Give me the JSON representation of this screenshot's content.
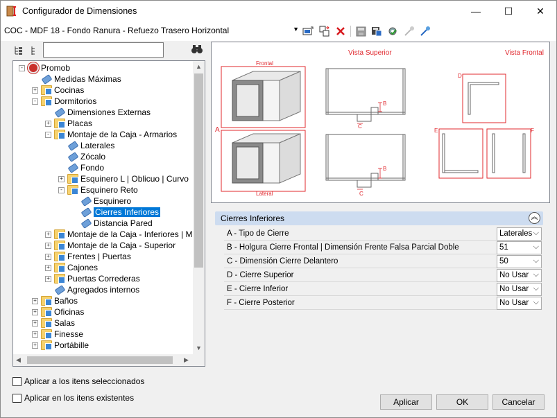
{
  "window": {
    "title": "Configurador de Dimensiones",
    "controls": {
      "minimize": "—",
      "maximize": "☐",
      "close": "✕"
    }
  },
  "toolbar": {
    "config_name": "COC - MDF 18 - Fondo Ranura - Refuezo Trasero Horizontal",
    "dropdown_arrow": "▼",
    "icons": [
      "new-config-icon",
      "copy-config-icon",
      "delete-config-icon",
      "save-icon",
      "save-as-icon",
      "settings-icon",
      "tool-disabled-icon",
      "tool-icon"
    ]
  },
  "tree_toolbar": {
    "search_value": "",
    "find_icon": "binoculars-icon"
  },
  "tree": {
    "items": [
      {
        "label": "Promob",
        "level": 0,
        "expander": "-",
        "icon": "root"
      },
      {
        "label": "Medidas Máximas",
        "level": 1,
        "expander": "",
        "icon": "tag"
      },
      {
        "label": "Cocinas",
        "level": 1,
        "expander": "+",
        "icon": "folder"
      },
      {
        "label": "Dormitorios",
        "level": 1,
        "expander": "-",
        "icon": "folder"
      },
      {
        "label": "Dimensiones Externas",
        "level": 2,
        "expander": "",
        "icon": "tag"
      },
      {
        "label": "Placas",
        "level": 2,
        "expander": "+",
        "icon": "folder"
      },
      {
        "label": "Montaje de la Caja - Armarios",
        "level": 2,
        "expander": "-",
        "icon": "folder"
      },
      {
        "label": "Laterales",
        "level": 3,
        "expander": "",
        "icon": "tag"
      },
      {
        "label": "Zócalo",
        "level": 3,
        "expander": "",
        "icon": "tag"
      },
      {
        "label": "Fondo",
        "level": 3,
        "expander": "",
        "icon": "tag"
      },
      {
        "label": "Esquinero L | Oblicuo | Curvo",
        "level": 3,
        "expander": "+",
        "icon": "folder"
      },
      {
        "label": "Esquinero Reto",
        "level": 3,
        "expander": "-",
        "icon": "folder"
      },
      {
        "label": "Esquinero",
        "level": 4,
        "expander": "",
        "icon": "tag"
      },
      {
        "label": "Cierres Inferiores",
        "level": 4,
        "expander": "",
        "icon": "tag",
        "selected": true
      },
      {
        "label": "Distancia Pared",
        "level": 4,
        "expander": "",
        "icon": "tag"
      },
      {
        "label": "Montaje de la Caja - Inferiores | Mesa",
        "level": 2,
        "expander": "+",
        "icon": "folder"
      },
      {
        "label": "Montaje de la Caja - Superior",
        "level": 2,
        "expander": "+",
        "icon": "folder"
      },
      {
        "label": "Frentes | Puertas",
        "level": 2,
        "expander": "+",
        "icon": "folder"
      },
      {
        "label": "Cajones",
        "level": 2,
        "expander": "+",
        "icon": "folder"
      },
      {
        "label": "Puertas Correderas",
        "level": 2,
        "expander": "+",
        "icon": "folder"
      },
      {
        "label": "Agregados internos",
        "level": 2,
        "expander": "",
        "icon": "tag"
      },
      {
        "label": "Baños",
        "level": 1,
        "expander": "+",
        "icon": "folder"
      },
      {
        "label": "Oficinas",
        "level": 1,
        "expander": "+",
        "icon": "folder"
      },
      {
        "label": "Salas",
        "level": 1,
        "expander": "+",
        "icon": "folder"
      },
      {
        "label": "Finesse",
        "level": 1,
        "expander": "+",
        "icon": "folder"
      },
      {
        "label": "Portábille",
        "level": 1,
        "expander": "+",
        "icon": "folder"
      }
    ]
  },
  "preview": {
    "vista_superior": "Vista Superior",
    "vista_frontal": "Vista Frontal",
    "frontal": "Frontal",
    "lateral": "Lateral",
    "letters": {
      "a": "A",
      "b": "B",
      "c": "C",
      "d": "D",
      "e": "E",
      "f": "F"
    }
  },
  "properties": {
    "group_title": "Cierres Inferiores",
    "collapse_icon": "︽",
    "rows": [
      {
        "label": "A - Tipo de Cierre",
        "value": "Laterales"
      },
      {
        "label": "B - Holgura Cierre Frontal | Dimensión Frente Falsa Parcial Doble",
        "value": "51"
      },
      {
        "label": "C - Dimensión Cierre Delantero",
        "value": "50"
      },
      {
        "label": "D - Cierre Superior",
        "value": "No Usar"
      },
      {
        "label": "E - Cierre Inferior",
        "value": "No Usar"
      },
      {
        "label": "F - Cierre Posterior",
        "value": "No Usar"
      }
    ],
    "chevron": "⌵"
  },
  "options": {
    "apply_selected": "Aplicar a los itens seleccionados",
    "apply_existing": "Aplicar en los itens existentes"
  },
  "buttons": {
    "apply": "Aplicar",
    "ok": "OK",
    "cancel": "Cancelar"
  },
  "colors": {
    "accent": "#0078d7",
    "drawing_red": "#e0282e",
    "group_header": "#cddcf0"
  }
}
